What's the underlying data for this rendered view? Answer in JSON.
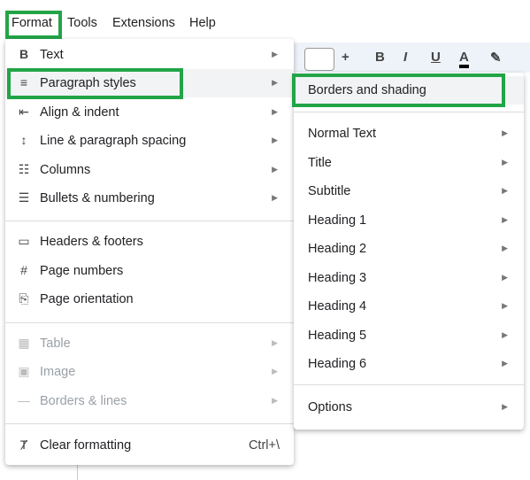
{
  "menubar": {
    "items": [
      "Format",
      "Tools",
      "Extensions",
      "Help"
    ]
  },
  "toolbar": {
    "plus": "+",
    "bold": "B",
    "italic": "I",
    "underline": "U",
    "text_color": "A"
  },
  "format_menu": {
    "items": [
      {
        "label": "Text",
        "icon": "bold-icon",
        "glyph": "B"
      },
      {
        "label": "Paragraph styles",
        "icon": "paragraph-icon",
        "glyph": "≡"
      },
      {
        "label": "Align & indent",
        "icon": "align-icon",
        "glyph": "⇤"
      },
      {
        "label": "Line & paragraph spacing",
        "icon": "line-spacing-icon",
        "glyph": "↕"
      },
      {
        "label": "Columns",
        "icon": "columns-icon",
        "glyph": "☷"
      },
      {
        "label": "Bullets & numbering",
        "icon": "bullets-icon",
        "glyph": "☰"
      },
      {
        "label": "Headers & footers",
        "icon": "header-icon",
        "glyph": "▭"
      },
      {
        "label": "Page numbers",
        "icon": "hash-icon",
        "glyph": "#"
      },
      {
        "label": "Page orientation",
        "icon": "page-orientation-icon",
        "glyph": "⎘"
      },
      {
        "label": "Table",
        "icon": "table-icon",
        "glyph": "▦"
      },
      {
        "label": "Image",
        "icon": "image-icon",
        "glyph": "▣"
      },
      {
        "label": "Borders & lines",
        "icon": "line-icon",
        "glyph": "—"
      },
      {
        "label": "Clear formatting",
        "icon": "clear-formatting-icon",
        "glyph": "Ⱦ",
        "shortcut": "Ctrl+\\"
      }
    ]
  },
  "paragraph_submenu": {
    "items": [
      "Borders and shading",
      "Normal Text",
      "Title",
      "Subtitle",
      "Heading 1",
      "Heading 2",
      "Heading 3",
      "Heading 4",
      "Heading 5",
      "Heading 6",
      "Options"
    ]
  },
  "colors": {
    "highlight_box": "#22a447",
    "hover": "#f1f3f4"
  }
}
